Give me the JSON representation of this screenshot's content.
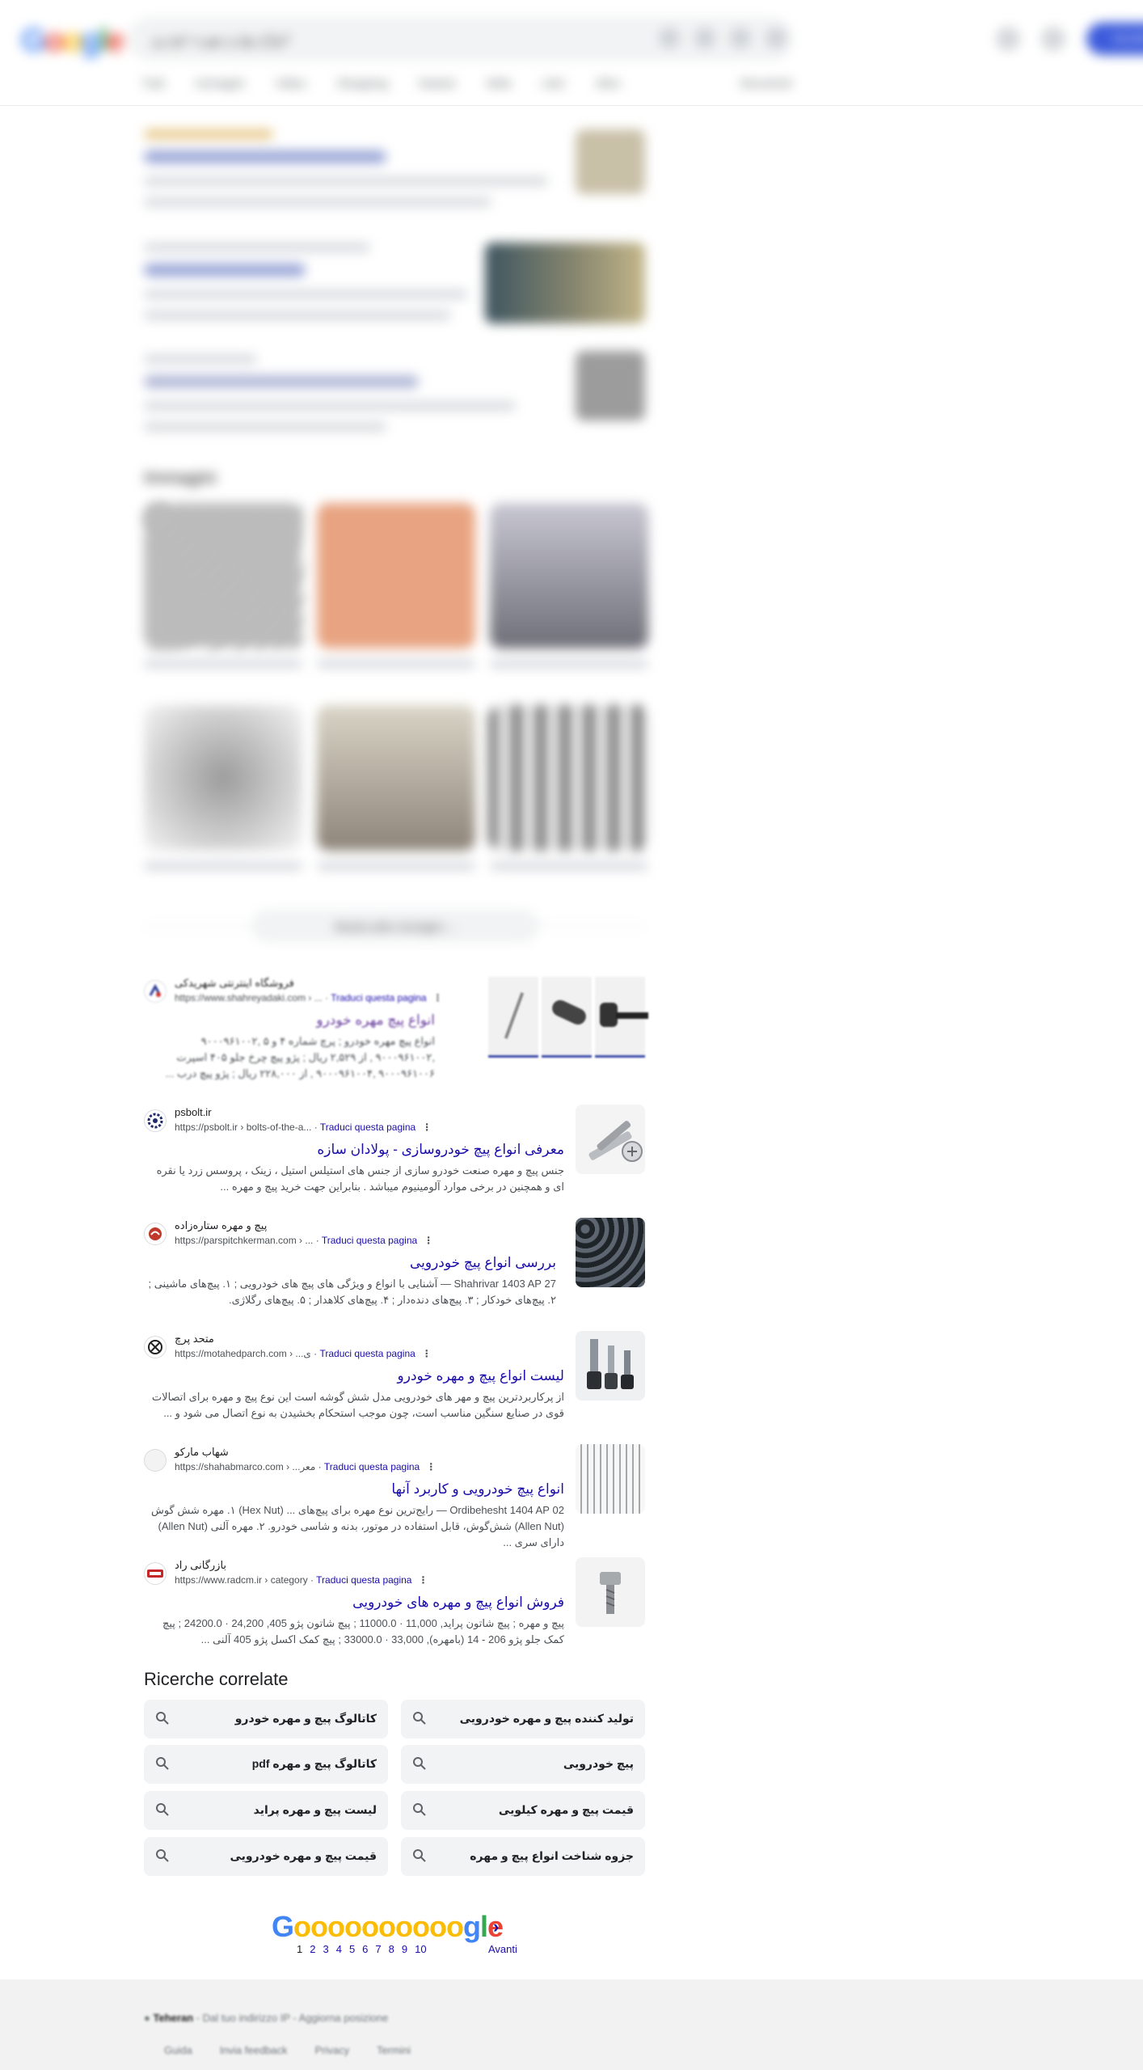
{
  "header": {
    "logo": "Google",
    "search_query": "انواع پیچ و مهره خودرو",
    "login_label": "Accedi",
    "tabs": [
      "Tutti",
      "Immagini",
      "Video",
      "Shopping",
      "Notizie",
      "Web",
      "Libri",
      "Altro"
    ],
    "tools_label": "Strumenti"
  },
  "images_section": {
    "title": "Immagini",
    "more_label": "Mostra altre immagini"
  },
  "results": [
    {
      "site": "فروشگاه اینترنتی شهریدکی",
      "url": "https://www.shahreyadaki.com › ...",
      "translate": "Traduci questa pagina",
      "title": "انواع پیچ مهره خودرو",
      "snippet": "انواع پیچ مهره خودرو ; پرچ شماره ۴ و ۵ ,۹۰۰۰۹۶۱۰۰۲ ,۹۰۰۰۹۶۱۰۰۲ , از ۲,۵۲۹ ریال ; پژو پیچ چرخ جلو ۴۰۵ اسپرت ۹۰۰۰۹۶۱۰۰۶ ,۹۰۰۰۹۶۱۰۰۴ , از ۲۲۸,۰۰۰ ریال ; پژو پیچ درب ..."
    },
    {
      "site": "psbolt.ir",
      "url": "https://psbolt.ir › bolts-of-the-a...",
      "translate": "Traduci questa pagina",
      "title": "معرفی انواع پیچ خودروسازی - پولادان سازه",
      "snippet": "جنس پیچ و مهره صنعت خودرو سازی از جنس های استیلس استیل ، زینک ، پروسس زرد یا نقره ای و همچنین در برخی موارد آلومینیوم میباشد . بنابراین جهت خرید پیچ و مهره ..."
    },
    {
      "site": "پیچ و مهره ستاره‌زاده",
      "url": "https://parspitchkerman.com › ...",
      "translate": "Traduci questa pagina",
      "title": "بررسی انواع پیچ خودرویی",
      "snippet": "27 Shahrivar 1403 AP — آشنایی با انواع و ویژگی های پیچ های خودرویی ; ۱. پیچ‌های ماشینی ; ۲. پیچ‌های خودکار ; ۳. پیچ‌های دندەدار ; ۴. پیچ‌های کلاهدار ; ۵. پیچ‌های رگلاژی."
    },
    {
      "site": "متحد پرچ",
      "url": "https://motahedparch.com › ...ی",
      "translate": "Traduci questa pagina",
      "title": "لیست انواع پیچ و مهره خودرو",
      "snippet": "از پرکاربردترین پیچ و مهر های خودرویی مدل شش گوشه است این نوع پیچ و مهره برای اتصالات قوی در صنایع سنگین مناسب است، چون موجب استحکام بخشیدن به نوع اتصال می شود و ..."
    },
    {
      "site": "شهاب مارکو",
      "url": "https://shahabmarco.com › ...معر",
      "translate": "Traduci questa pagina",
      "title": "انواع پیچ خودرویی و کاربرد آنها",
      "snippet": "02 Ordibehesht 1404 AP — رایج‌ترین نوع مهره برای پیچ‌های ... (Hex Nut) ۱. مهره شش گوش (Allen Nut) شش‌گوش، قابل استفاده در موتور، بدنه و شاسی خودرو. ۲. مهره آلنی (Allen Nut) دارای سری ..."
    },
    {
      "site": "بازرگانی راد",
      "url": "https://www.radcm.ir › category",
      "translate": "Traduci questa pagina",
      "title": "فروش انواع پیچ و مهره های خودرویی",
      "snippet": "پیچ و مهره ; پیچ شاتون پراید, 11,000 · 11000.0 ; پیچ شاتون پژو 405, 24,200 · 24200.0 ; پیچ کمک جلو پژو 206 - 14 (بامهره), 33,000 · 33000.0 ; پیچ کمک اکسل پژو 405 آلنی ..."
    }
  ],
  "related": {
    "title": "Ricerche correlate",
    "items": [
      "کاتالوگ پیچ و مهره خودرو",
      "تولید کننده پیچ و مهره خودرویی",
      "کاتالوگ پیچ و مهره pdf",
      "پیچ خودرویی",
      "لیست پیچ و مهره پراید",
      "قیمت پیچ و مهره کیلویی",
      "قیمت پیچ و مهره خودرویی",
      "جزوه شناخت انواع پیچ و مهره"
    ]
  },
  "pagination": {
    "pages": [
      "1",
      "2",
      "3",
      "4",
      "5",
      "6",
      "7",
      "8",
      "9",
      "10"
    ],
    "next_label": "Avanti"
  },
  "footer": {
    "location": "Teheran",
    "location_detail": " - Dal tuo indirizzo IP - Aggiorna posizione",
    "links": [
      "Guida",
      "Invia feedback",
      "Privacy",
      "Termini"
    ]
  },
  "colors": {
    "link": "#1a0dab",
    "snippet": "#4d5156",
    "chip_bg": "#f1f3f4",
    "footer_bg": "#f2f2f2",
    "google_blue": "#4285f4",
    "google_red": "#ea4335",
    "google_yellow": "#fbbc05",
    "google_green": "#34a853"
  }
}
